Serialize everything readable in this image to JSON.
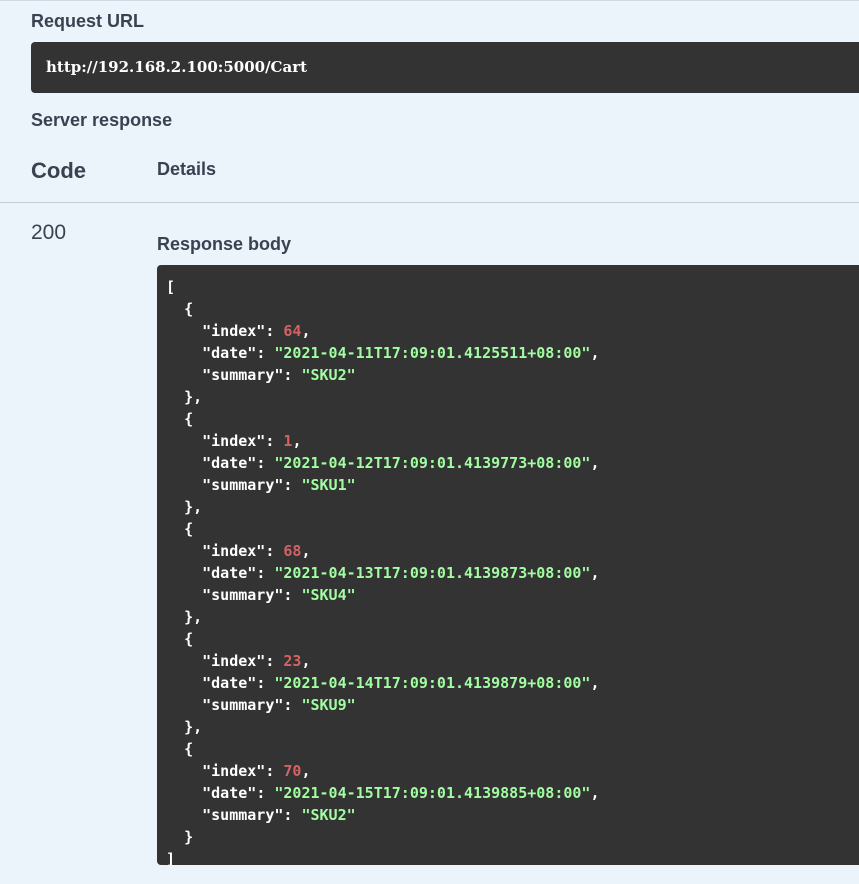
{
  "request_url": {
    "label": "Request URL",
    "value": "http://192.168.2.100:5000/Cart"
  },
  "server_response": {
    "label": "Server response",
    "columns": {
      "code": "Code",
      "details": "Details"
    },
    "status_code": "200",
    "response_body_label": "Response body",
    "items": [
      {
        "index": "64",
        "date": "\"2021-04-11T17:09:01.4125511+08:00\"",
        "summary": "\"SKU2\""
      },
      {
        "index": "1",
        "date": "\"2021-04-12T17:09:01.4139773+08:00\"",
        "summary": "\"SKU1\""
      },
      {
        "index": "68",
        "date": "\"2021-04-13T17:09:01.4139873+08:00\"",
        "summary": "\"SKU4\""
      },
      {
        "index": "23",
        "date": "\"2021-04-14T17:09:01.4139879+08:00\"",
        "summary": "\"SKU9\""
      },
      {
        "index": "70",
        "date": "\"2021-04-15T17:09:01.4139885+08:00\"",
        "summary": "\"SKU2\""
      }
    ]
  },
  "json_tokens": {
    "open_array": "[",
    "close_array": "]",
    "open_object": "{",
    "close_object": "}",
    "close_object_comma": "},",
    "key_index": "\"index\"",
    "key_date": "\"date\"",
    "key_summary": "\"summary\""
  },
  "colors": {
    "page_background": "#ebf3fb",
    "code_background": "#333333",
    "number": "#d36363",
    "string": "#a2fca2",
    "text": "#3b4151"
  }
}
